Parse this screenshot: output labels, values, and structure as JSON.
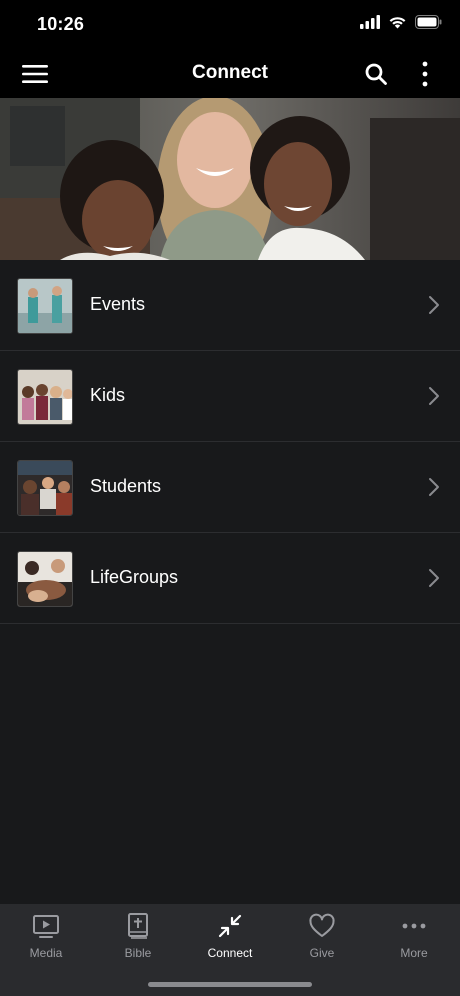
{
  "status_bar": {
    "time": "10:26"
  },
  "nav": {
    "title": "Connect"
  },
  "list": {
    "items": [
      {
        "label": "Events"
      },
      {
        "label": "Kids"
      },
      {
        "label": "Students"
      },
      {
        "label": "LifeGroups"
      }
    ]
  },
  "tab_bar": {
    "tabs": [
      {
        "label": "Media",
        "icon": "tv-icon"
      },
      {
        "label": "Bible",
        "icon": "bible-icon"
      },
      {
        "label": "Connect",
        "icon": "compress-arrows-icon",
        "active": true
      },
      {
        "label": "Give",
        "icon": "heart-icon"
      },
      {
        "label": "More",
        "icon": "more-dots-icon"
      }
    ]
  },
  "colors": {
    "background": "#18191b",
    "tab_bar": "#2a2b2e",
    "active": "#ffffff",
    "inactive": "#9a9ba0"
  }
}
